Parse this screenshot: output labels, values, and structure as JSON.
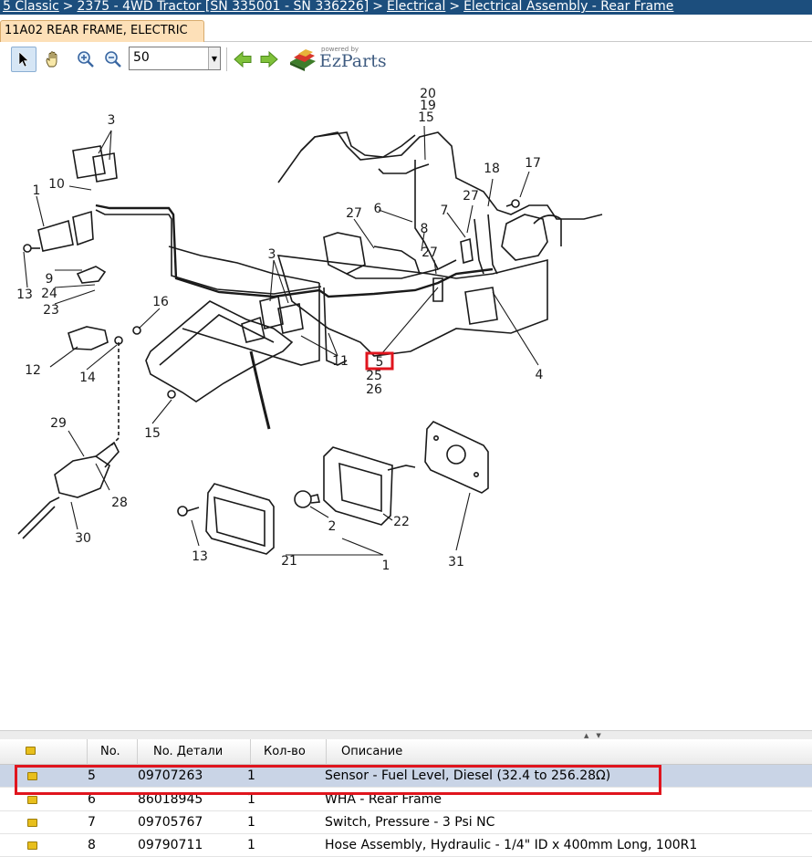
{
  "breadcrumb": [
    {
      "label": "5 Classic"
    },
    {
      "label": "2375 - 4WD Tractor [SN 335001 - SN 336226]"
    },
    {
      "label": "Electrical"
    },
    {
      "label": "Electrical Assembly - Rear Frame"
    }
  ],
  "breadcrumb_separator": ">",
  "tab": {
    "label": "11A02 REAR FRAME, ELECTRIC"
  },
  "toolbar": {
    "zoom_value": "50",
    "brand_powered": "powered by",
    "brand_name": "EzParts",
    "icons": [
      "pointer-icon",
      "hand-icon",
      "zoom-in-icon",
      "zoom-out-icon",
      "arrow-left-icon",
      "arrow-right-icon",
      "ezparts-logo-icon"
    ]
  },
  "diagram": {
    "callouts": [
      "20",
      "19",
      "15",
      "3",
      "18",
      "17",
      "10",
      "27",
      "6",
      "7",
      "1",
      "8",
      "27",
      "27",
      "3",
      "9",
      "24",
      "13",
      "23",
      "16",
      "11",
      "5",
      "25",
      "26",
      "4",
      "12",
      "14",
      "15",
      "29",
      "28",
      "30",
      "2",
      "22",
      "13",
      "21",
      "1",
      "31"
    ],
    "highlight_callout": "5",
    "highlight_color": "#e0151e"
  },
  "grid": {
    "columns": [
      "",
      "No.",
      "No. Детали",
      "Кол-во",
      "Описание"
    ],
    "rows": [
      {
        "no": "5",
        "part": "09707263",
        "qty": "1",
        "desc": "Sensor - Fuel Level, Diesel (32.4 to 256.28Ω)",
        "selected": true
      },
      {
        "no": "6",
        "part": "86018945",
        "qty": "1",
        "desc": "WHA - Rear Frame",
        "selected": false
      },
      {
        "no": "7",
        "part": "09705767",
        "qty": "1",
        "desc": "Switch, Pressure - 3 Psi NC",
        "selected": false
      },
      {
        "no": "8",
        "part": "09790711",
        "qty": "1",
        "desc": "Hose Assembly, Hydraulic - 1/4\" ID x 400mm Long, 100R1",
        "selected": false
      }
    ],
    "selected_color": "#c9d4e6",
    "highlight_color": "#e0151e"
  }
}
